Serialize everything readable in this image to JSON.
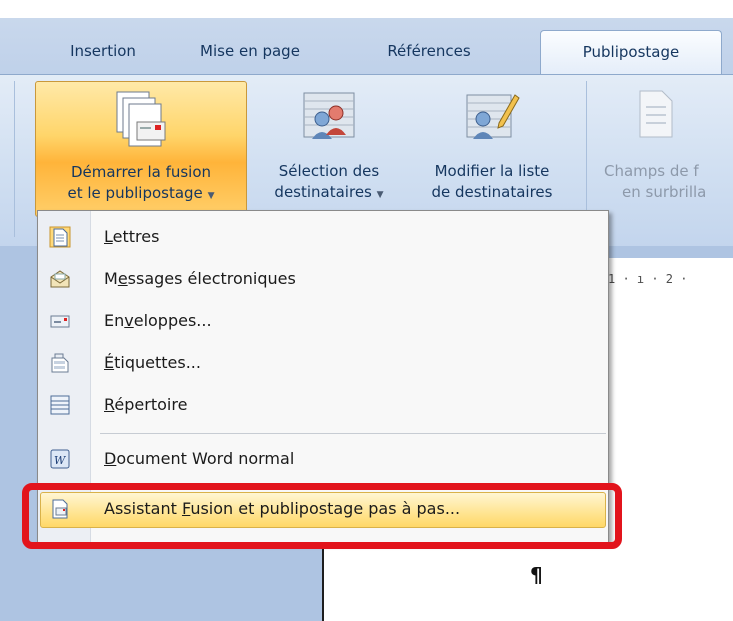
{
  "ribbon": {
    "tabs": [
      {
        "label": "Insertion"
      },
      {
        "label": "Mise en page"
      },
      {
        "label": "Références"
      },
      {
        "label": "Publipostage",
        "active": true
      }
    ],
    "buttons": {
      "start_merge": {
        "line1": "Démarrer la fusion",
        "line2": "et le publipostage",
        "has_dropdown": true
      },
      "select_recipients": {
        "line1": "Sélection des",
        "line2": "destinataires",
        "has_dropdown": true
      },
      "edit_list": {
        "line1": "Modifier la liste",
        "line2": "de destinataires"
      },
      "highlight_fields": {
        "line1": "Champs de f",
        "line2": "en surbrilla",
        "enabled": false
      }
    }
  },
  "ruler": {
    "text": "1 · ı · 2 ·"
  },
  "menu": {
    "items": [
      {
        "prefix": "",
        "key": "L",
        "suffix": "ettres",
        "icon": "letter-doc-icon"
      },
      {
        "prefix": "M",
        "key": "e",
        "suffix": "ssages électroniques",
        "icon": "envelope-open-icon"
      },
      {
        "prefix": "En",
        "key": "v",
        "suffix": "eloppes...",
        "icon": "envelope-icon"
      },
      {
        "prefix": "",
        "key": "É",
        "suffix": "tiquettes...",
        "icon": "labels-icon"
      },
      {
        "prefix": "",
        "key": "R",
        "suffix": "épertoire",
        "icon": "directory-icon"
      },
      {
        "prefix": "",
        "key": "D",
        "suffix": "ocument Word normal",
        "icon": "word-doc-icon"
      },
      {
        "prefix": "Assistant ",
        "key": "F",
        "suffix": "usion et publipostage pas à pas...",
        "icon": "wizard-icon",
        "highlighted": true
      }
    ]
  },
  "document": {
    "pilcrow": "¶"
  },
  "colors": {
    "annotation_box": "#e2141c",
    "menu_hover": "#ffe79b",
    "button_hover": "#ffc24a"
  }
}
